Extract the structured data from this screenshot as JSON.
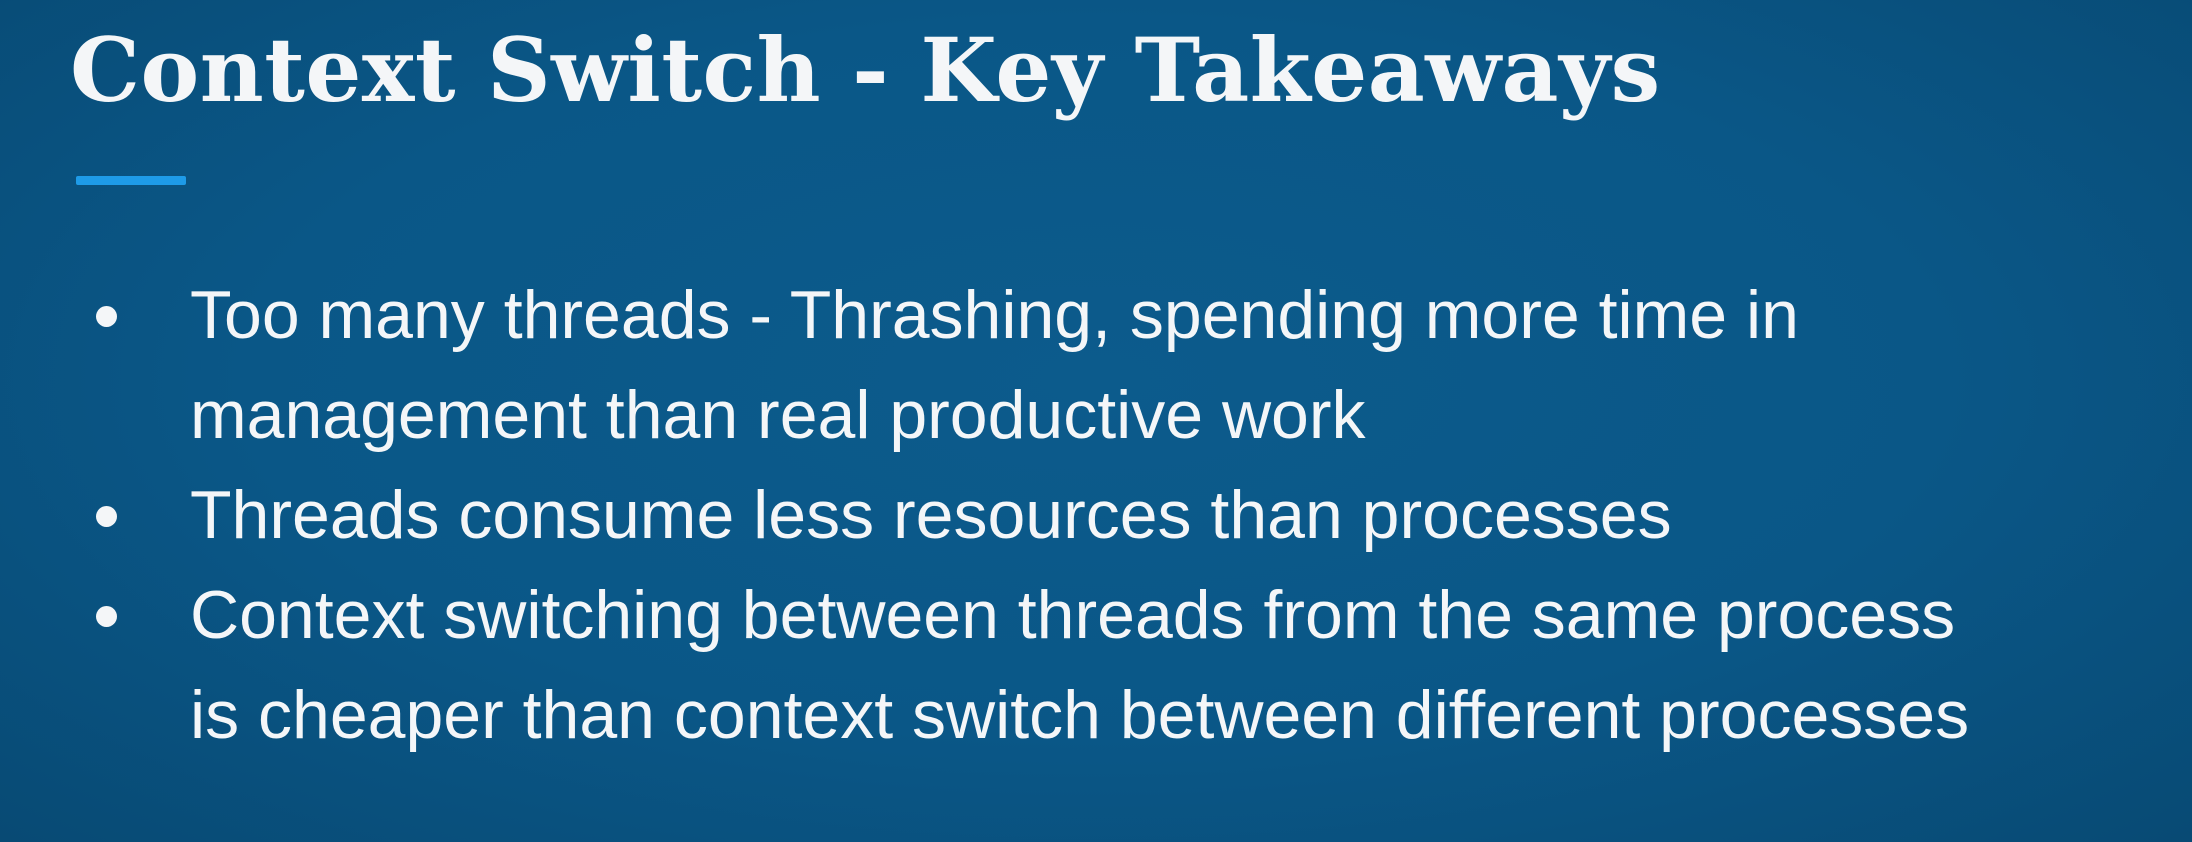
{
  "slide": {
    "title": "Context Switch - Key Takeaways",
    "bullets": [
      {
        "line1": "Too many threads - Thrashing, spending more time in",
        "line2": "management than real productive work"
      },
      {
        "line1": "Threads consume less resources than processes",
        "line2": ""
      },
      {
        "line1": "Context switching between threads from the same process",
        "line2": "is cheaper than context switch between different processes"
      }
    ]
  },
  "colors": {
    "background": "#0a5787",
    "accent": "#1e9be8",
    "text": "#f4f6f8"
  }
}
